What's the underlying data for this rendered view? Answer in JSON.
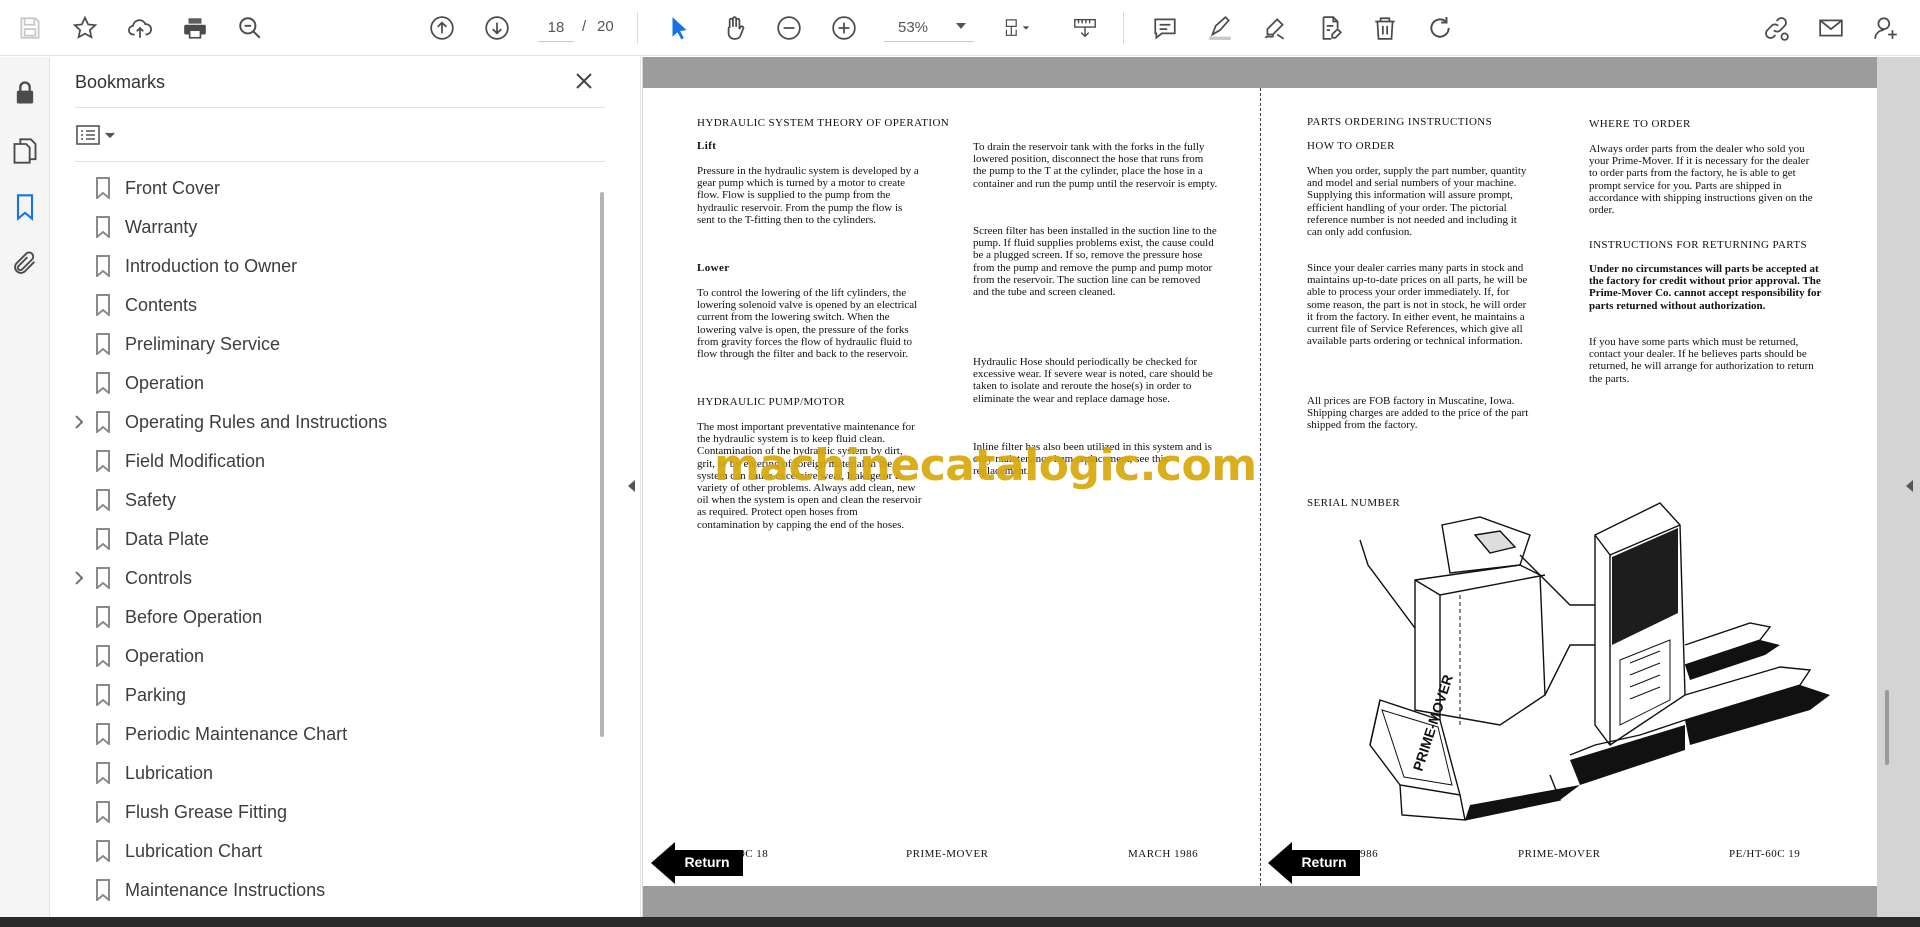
{
  "toolbar": {
    "page_current": "18",
    "page_separator": "/",
    "page_total": "20",
    "zoom": "53%"
  },
  "panel": {
    "title": "Bookmarks",
    "items": [
      {
        "label": "Front Cover",
        "expandable": false
      },
      {
        "label": "Warranty",
        "expandable": false
      },
      {
        "label": "Introduction to Owner",
        "expandable": false
      },
      {
        "label": "Contents",
        "expandable": false
      },
      {
        "label": "Preliminary Service",
        "expandable": false
      },
      {
        "label": "Operation",
        "expandable": false
      },
      {
        "label": "Operating Rules and Instructions",
        "expandable": true
      },
      {
        "label": "Field Modification",
        "expandable": false
      },
      {
        "label": "Safety",
        "expandable": false
      },
      {
        "label": "Data Plate",
        "expandable": false
      },
      {
        "label": "Controls",
        "expandable": true
      },
      {
        "label": "Before Operation",
        "expandable": false
      },
      {
        "label": "Operation",
        "expandable": false
      },
      {
        "label": "Parking",
        "expandable": false
      },
      {
        "label": "Periodic Maintenance Chart",
        "expandable": false
      },
      {
        "label": "Lubrication",
        "expandable": false
      },
      {
        "label": "Flush Grease Fitting",
        "expandable": false
      },
      {
        "label": "Lubrication Chart",
        "expandable": false
      },
      {
        "label": "Maintenance Instructions",
        "expandable": false
      }
    ]
  },
  "document": {
    "left_page": {
      "heading": "HYDRAULIC SYSTEM THEORY OF OPERATION",
      "lift_title": "Lift",
      "lift_text": "Pressure in the hydraulic system is developed by a gear pump which is turned by a motor to create flow. Flow is supplied to the pump from the hydraulic reservoir. From the pump the flow is sent to the T-fitting then to the cylinders.",
      "lower_title": "Lower",
      "lower_text": "To control the lowering of the lift cylinders, the lowering solenoid valve is opened by an electrical current from the lowering switch. When the lowering valve is open, the pressure of the forks from gravity forces the flow of hydraulic fluid to flow through the filter and back to the reservoir.",
      "pump_title": "HYDRAULIC PUMP/MOTOR",
      "pump_text": "The most important preventative maintenance for the hydraulic system is to keep fluid clean. Contamination of the hydraulic system by dirt, grit, or by entering of foreign material in the system can cause excessive wear, leakage or a variety of other problems. Always add clean, new oil when the system is open and clean the reservoir as required. Protect open hoses from contamination by capping the end of the hoses.",
      "drain_text": "To drain the reservoir tank with the forks in the fully lowered position, disconnect the hose that runs from the pump to the T at the cylinder, place the hose in a container and run the pump until the reservoir is empty.",
      "screen_text": "Screen filter has been installed in the suction line to the pump. If fluid supplies problems exist, the cause could be a plugged screen. If so, remove the pressure hose from the pump and remove the pump and pump motor from the reservoir. The suction line can be removed and the tube and screen cleaned.",
      "hose_text": "Hydraulic Hose should periodically be checked for excessive wear. If severe wear is noted, care should be taken to isolate and reroute the hose(s) in order to eliminate the wear and replace damage hose.",
      "inline_text": "Inline filter has also been utilized in this system and is only maintenance item replacement, see this replacement.",
      "footer_left": "PE/HT-60C   18",
      "footer_center": "PRIME-MOVER",
      "footer_right": "MARCH 1986"
    },
    "right_page": {
      "heading": "PARTS ORDERING INSTRUCTIONS",
      "how_title": "HOW TO ORDER",
      "how_text": "When you order, supply the part number, quantity and model and serial numbers of your machine. Supplying this information will assure prompt, efficient handling of your order. The pictorial reference number is not needed and including it can only add confusion.",
      "dealer_text": "Since your dealer carries many parts in stock and maintains up-to-date prices on all parts, he will be able to process your order immediately. If, for some reason, the part is not in stock, he will order it from the factory. In either event, he maintains a current file of Service References, which give all available parts ordering or technical information.",
      "prices_text": "All prices are FOB factory in Muscatine, Iowa. Shipping charges are added to the price of the part shipped from the factory.",
      "where_title": "WHERE TO ORDER",
      "where_text": "Always order parts from the dealer who sold you your Prime-Mover. If it is necessary for the dealer to order parts from the factory, he is able to get prompt service for you. Parts are shipped in accordance with shipping instructions given on the order.",
      "returning_title": "INSTRUCTIONS FOR RETURNING PARTS",
      "returning_bold": "Under no circumstances will parts be accepted at the factory for credit without prior approval. The Prime-Mover Co. cannot accept responsibility for parts returned without authorization.",
      "returning_text": "If you have some parts which must be returned, contact your dealer. If he believes parts should be returned, he will arrange for authorization to return the parts.",
      "serial_label": "SERIAL NUMBER",
      "truck_brand": "PRIME-MOVER",
      "footer_left": "MARCH 1986",
      "footer_center": "PRIME-MOVER",
      "footer_right": "PE/HT-60C   19"
    },
    "return_label": "Return",
    "watermark": "machinecatalogic.com"
  }
}
